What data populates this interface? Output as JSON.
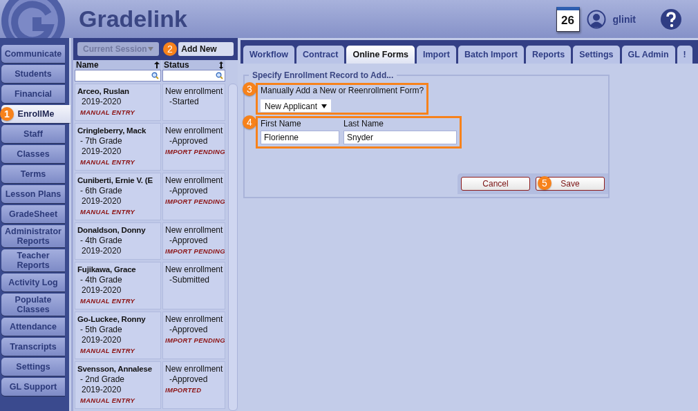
{
  "app": {
    "name": "Gradelink"
  },
  "header": {
    "calendar_day": "26",
    "user": "glinit"
  },
  "sidebar": {
    "items": [
      {
        "label": "Communicate",
        "selected": false
      },
      {
        "label": "Students",
        "selected": false
      },
      {
        "label": "Financial",
        "selected": false
      },
      {
        "label": "EnrollMe",
        "selected": true,
        "callout": "1"
      },
      {
        "label": "Staff",
        "selected": false
      },
      {
        "label": "Classes",
        "selected": false
      },
      {
        "label": "Terms",
        "selected": false
      },
      {
        "label": "Lesson Plans",
        "selected": false
      },
      {
        "label": "GradeSheet",
        "selected": false
      },
      {
        "label": "Administrator Reports",
        "selected": false
      },
      {
        "label": "Teacher Reports",
        "selected": false
      },
      {
        "label": "Activity Log",
        "selected": false
      },
      {
        "label": "Populate Classes",
        "selected": false
      },
      {
        "label": "Attendance",
        "selected": false
      },
      {
        "label": "Transcripts",
        "selected": false
      },
      {
        "label": "Settings",
        "selected": false
      },
      {
        "label": "GL Support",
        "selected": false
      }
    ]
  },
  "list_panel": {
    "session_select": {
      "value": "Current Session",
      "disabled": true
    },
    "add_button": {
      "label": "Add New",
      "callout": "2"
    },
    "columns": [
      {
        "label": "Name",
        "sorted": true
      },
      {
        "label": "Status",
        "sorted": false
      }
    ],
    "rows": [
      {
        "name": "Arceo, Ruslan",
        "year": "2019-2020",
        "entry": "MANUAL ENTRY",
        "status": "New enrollment",
        "state": "-Started"
      },
      {
        "name": "Cringleberry, Mack",
        "grade": "- 7th Grade",
        "year": "2019-2020",
        "entry": "MANUAL ENTRY",
        "status": "New enrollment",
        "state": "-Approved",
        "import": "IMPORT PENDING"
      },
      {
        "name": "Cuniberti, Ernie V. (E",
        "grade": "- 6th Grade",
        "year": "2019-2020",
        "entry": "MANUAL ENTRY",
        "status": "New enrollment",
        "state": "-Approved",
        "import": "IMPORT PENDING"
      },
      {
        "name": "Donaldson, Donny",
        "grade": "- 4th Grade",
        "year": "2019-2020",
        "status": "New enrollment",
        "state": "-Approved",
        "import": "IMPORT PENDING"
      },
      {
        "name": "Fujikawa, Grace",
        "grade": "- 4th Grade",
        "year": "2019-2020",
        "entry": "MANUAL ENTRY",
        "status": "New enrollment",
        "state": "-Submitted"
      },
      {
        "name": "Go-Luckee, Ronny",
        "grade": "- 5th Grade",
        "year": "2019-2020",
        "entry": "MANUAL ENTRY",
        "status": "New enrollment",
        "state": "-Approved",
        "import": "IMPORT PENDING"
      },
      {
        "name": "Svensson, Annalese",
        "grade": "- 2nd Grade",
        "year": "2019-2020",
        "entry": "MANUAL ENTRY",
        "status": "New enrollment",
        "state": "-Approved",
        "import": "IMPORTED"
      }
    ]
  },
  "tabs": [
    {
      "label": "Workflow",
      "selected": false
    },
    {
      "label": "Contract",
      "selected": false
    },
    {
      "label": "Online Forms",
      "selected": true
    },
    {
      "label": "Import",
      "selected": false
    },
    {
      "label": "Batch Import",
      "selected": false
    },
    {
      "label": "Reports",
      "selected": false
    },
    {
      "label": "Settings",
      "selected": false
    },
    {
      "label": "GL Admin",
      "selected": false
    },
    {
      "label": "!",
      "selected": false
    }
  ],
  "form": {
    "legend": "Specify Enrollment Record to Add...",
    "type_question": {
      "label": "Manually Add a New or Reenrollment Form?",
      "value": "New Applicant",
      "callout": "3"
    },
    "name_group": {
      "callout": "4",
      "fields": [
        {
          "label": "First Name",
          "value": "Florienne"
        },
        {
          "label": "Last Name",
          "value": "Snyder"
        }
      ]
    },
    "buttons": [
      {
        "label": "Cancel"
      },
      {
        "label": "Save",
        "callout": "5"
      }
    ]
  }
}
